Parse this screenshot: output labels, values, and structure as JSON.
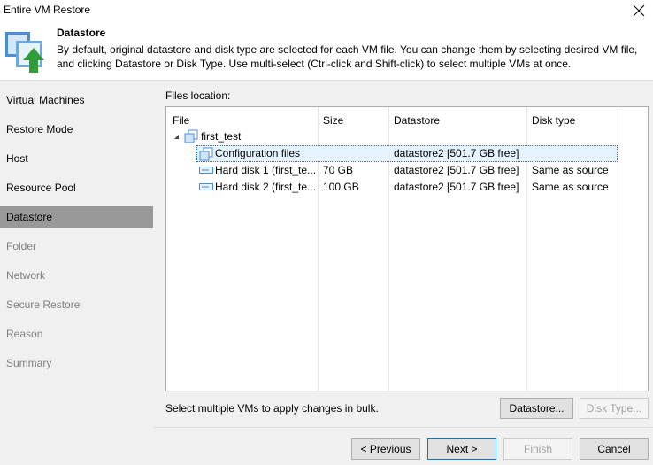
{
  "window": {
    "title": "Entire VM Restore"
  },
  "header": {
    "title": "Datastore",
    "description": "By default, original datastore and disk type are selected for each VM file. You can change them by selecting desired VM file, and clicking Datastore or Disk Type. Use multi-select (Ctrl-click and Shift-click) to select multiple VMs at once.",
    "icon": "vm-restore-icon"
  },
  "sidebar": {
    "steps": [
      {
        "label": "Virtual Machines",
        "state": "done"
      },
      {
        "label": "Restore Mode",
        "state": "done"
      },
      {
        "label": "Host",
        "state": "done"
      },
      {
        "label": "Resource Pool",
        "state": "done"
      },
      {
        "label": "Datastore",
        "state": "active"
      },
      {
        "label": "Folder",
        "state": "disabled"
      },
      {
        "label": "Network",
        "state": "disabled"
      },
      {
        "label": "Secure Restore",
        "state": "disabled"
      },
      {
        "label": "Reason",
        "state": "disabled"
      },
      {
        "label": "Summary",
        "state": "disabled"
      }
    ]
  },
  "main": {
    "files_label": "Files location:",
    "columns": [
      "File",
      "Size",
      "Datastore",
      "Disk type"
    ],
    "vm": {
      "name": "first_test"
    },
    "rows": [
      {
        "file": "Configuration files",
        "size": "",
        "datastore": "datastore2 [501.7 GB free]",
        "disk_type": "",
        "selected": true,
        "icon": "config-files-icon"
      },
      {
        "file": "Hard disk 1 (first_te...",
        "size": "70 GB",
        "datastore": "datastore2 [501.7 GB free]",
        "disk_type": "Same as source",
        "selected": false,
        "icon": "hard-disk-icon"
      },
      {
        "file": "Hard disk 2 (first_te...",
        "size": "100 GB",
        "datastore": "datastore2 [501.7 GB free]",
        "disk_type": "Same as source",
        "selected": false,
        "icon": "hard-disk-icon"
      }
    ],
    "hint": "Select multiple VMs to apply changes in bulk.",
    "datastore_button": "Datastore...",
    "disk_type_button": "Disk Type..."
  },
  "footer": {
    "previous": "< Previous",
    "next": "Next >",
    "finish": "Finish",
    "cancel": "Cancel"
  },
  "colors": {
    "active_step": "#999999",
    "selection_border": "#0078d7",
    "selection_fill": "#e5f3ff",
    "accent_arrow": "#2e9d3a"
  }
}
